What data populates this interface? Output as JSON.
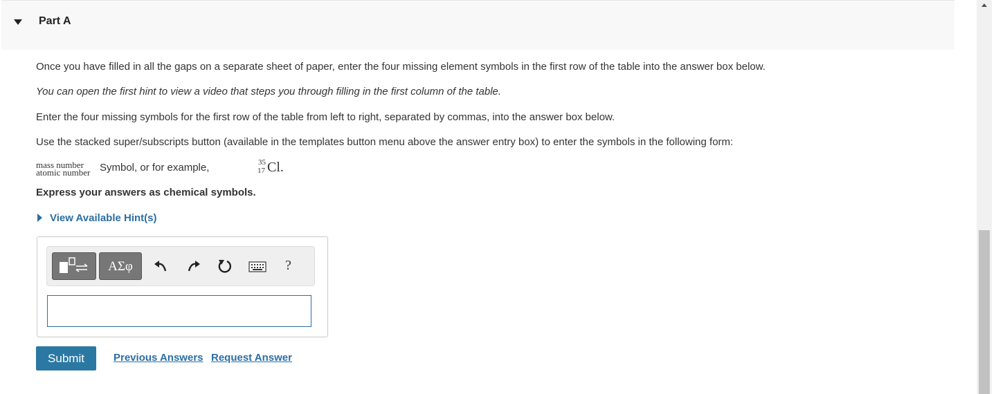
{
  "part": {
    "title": "Part A"
  },
  "instructions": {
    "line1": "Once you have filled in all the gaps on a separate sheet of paper, enter the four missing element symbols in the first row of the table into the answer box below.",
    "line2": "You can open the first hint to view a video that steps you through filling in the first column of the table.",
    "line3": "Enter the four missing symbols for the first row of the table from left to right, separated by commas, into the answer box below.",
    "line4": "Use the stacked super/subscripts button (available in the templates button menu above the answer entry box) to enter the symbols in the following form:"
  },
  "form_example": {
    "mass_label": "mass number",
    "atomic_label": "atomic number",
    "text": "Symbol, or for example,",
    "mass": "35",
    "atomic": "17",
    "symbol": "Cl",
    "period": "."
  },
  "express": "Express your answers as chemical symbols.",
  "hint": {
    "label": "View Available Hint(s)"
  },
  "toolbar": {
    "symbols_label": "ΑΣφ",
    "help_label": "?",
    "icons": [
      "templates-icon",
      "undo-icon",
      "redo-icon",
      "reset-icon",
      "keyboard-icon",
      "help-icon"
    ]
  },
  "answer": {
    "value": ""
  },
  "actions": {
    "submit": "Submit",
    "previous": "Previous Answers",
    "request": "Request Answer"
  },
  "colors": {
    "accent": "#2b6ea2",
    "submit_bg": "#2b78a3",
    "toolbar_button": "#777777"
  }
}
